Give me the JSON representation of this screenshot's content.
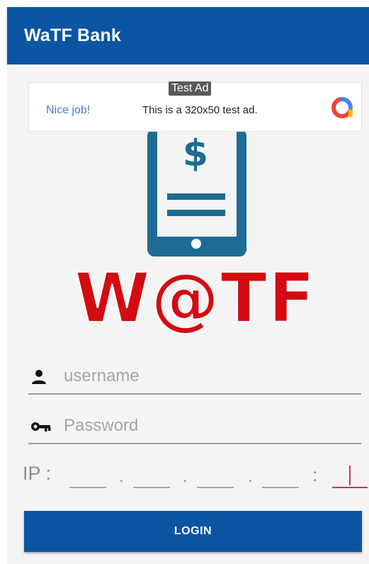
{
  "app_bar": {
    "title": "WaTF Bank"
  },
  "ad": {
    "label": "Test Ad",
    "left_text": "Nice job!",
    "center_text": "This is a 320x50 test ad.",
    "icon": "admob-logo-icon"
  },
  "logo": {
    "text": "W@TF",
    "phone_color": "#1e6b94",
    "text_color": "#d30b12"
  },
  "form": {
    "username": {
      "placeholder": "username",
      "value": "",
      "icon": "person-icon"
    },
    "password": {
      "placeholder": "Password",
      "value": "",
      "icon": "key-icon"
    },
    "ip": {
      "label": "IP :",
      "segments": [
        "",
        "",
        "",
        ""
      ],
      "separator": ".",
      "port_separator": ":",
      "port": ""
    }
  },
  "login_button": {
    "label": "LOGIN"
  },
  "colors": {
    "primary": "#0b55a3",
    "accent": "#d1315d",
    "background": "#f4f4f4"
  }
}
